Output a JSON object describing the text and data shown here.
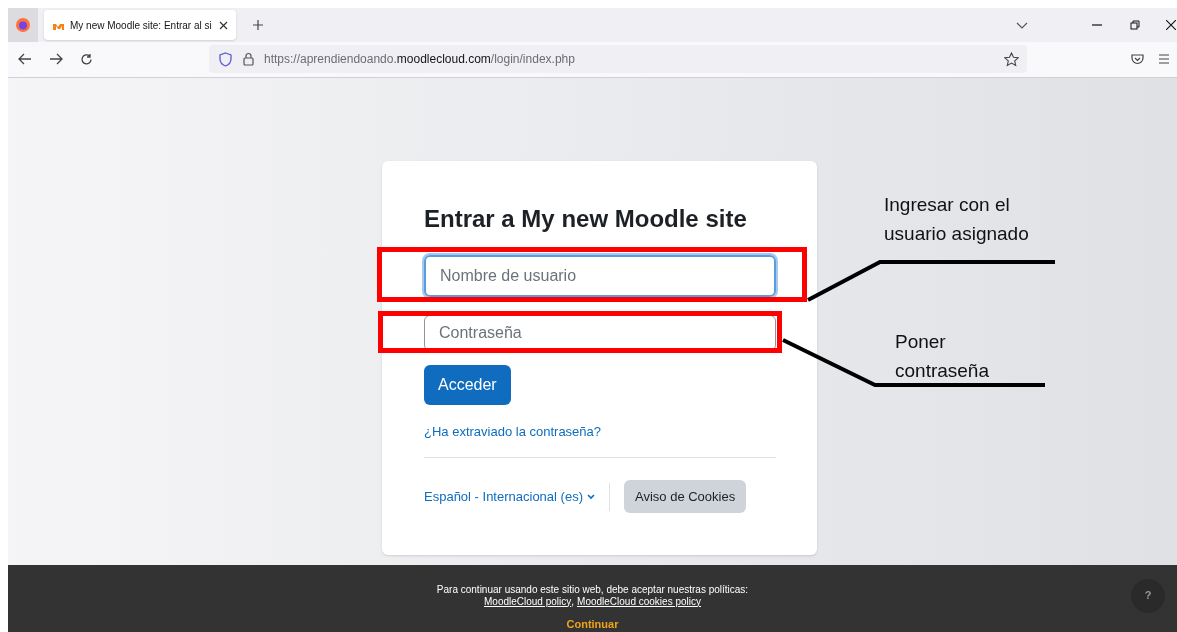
{
  "browser": {
    "tab_title": "My new Moodle site: Entrar al si",
    "tab_selected": true,
    "url_prefix": "https://aprendiendoando.",
    "url_host": "moodlecloud.com",
    "url_path": "/login/index.php"
  },
  "login": {
    "title": "Entrar a My new Moodle site",
    "username": {
      "placeholder": "Nombre de usuario",
      "focused": true
    },
    "password": {
      "placeholder": "Contraseña",
      "focused": false
    },
    "submit": "Acceder",
    "forgot_link": "¿Ha extraviado la contraseña?",
    "language": "Español - Internacional (es)",
    "cookies_button": "Aviso de Cookies"
  },
  "cookie_banner": {
    "message": "Para continuar usando este sitio web, debe aceptar nuestras políticas:",
    "links": [
      "MoodleCloud policy",
      "MoodleCloud cookies policy"
    ],
    "separator": ",",
    "continue": "Continuar",
    "help": "?"
  },
  "annotations": [
    {
      "text": "Ingresar con el usuario asignado"
    },
    {
      "text": "Poner contraseña"
    }
  ]
}
